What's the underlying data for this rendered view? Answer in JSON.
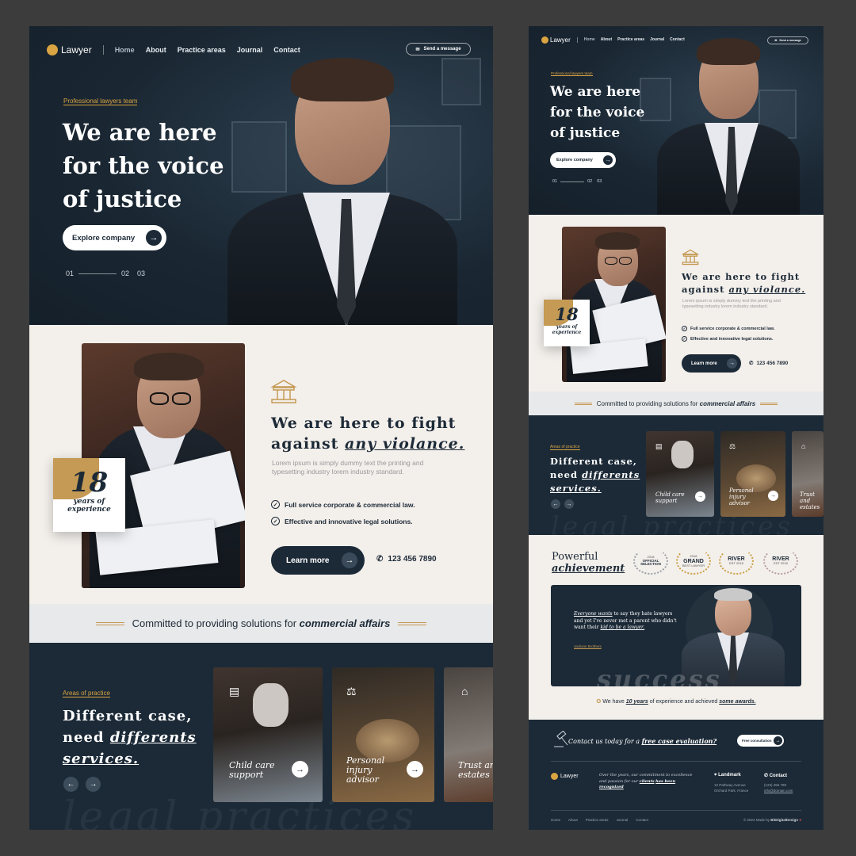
{
  "brand": {
    "logo": "Lawyer",
    "logo_icon": "pillar-icon",
    "accent": "#d9a441",
    "navy": "#1c2a37",
    "cream": "#f3efeb"
  },
  "nav": {
    "items": [
      "Home",
      "About",
      "Practice areas",
      "Journal",
      "Contact"
    ],
    "message": "Send a message"
  },
  "hero": {
    "eyebrow": "Professional lawyers team",
    "title_lines": [
      "We are here",
      "for the voice",
      "of justice"
    ],
    "cta": "Explore company",
    "slides": [
      "01",
      "02",
      "03"
    ]
  },
  "about": {
    "years": "18",
    "years_label_1": "years of",
    "years_label_2": "experience",
    "title_1": "We are here to fight",
    "title_2a": "against",
    "title_2b": "any violance.",
    "text": "Lorem ipsum is simply dummy text the printing and typesetting industry lorem industry standard.",
    "checks": [
      "Full service corporate & commercial law.",
      "Effective and innovative legal solutions."
    ],
    "learn": "Learn more",
    "phone": "123 456 7890"
  },
  "committed": {
    "text": "Committed to providing solutions for",
    "bold": "commercial affairs"
  },
  "practice": {
    "eyebrow": "Areas of practice",
    "title_1": "Different case,",
    "title_2a": "need",
    "title_2b": "differents",
    "title_3": "services.",
    "cards": [
      {
        "caption_1": "Child care",
        "caption_2": "support"
      },
      {
        "caption_1": "Personal",
        "caption_2": "injury",
        "caption_3": "advisor"
      },
      {
        "caption_1": "Trust and",
        "caption_2": "estates"
      }
    ],
    "watermark": "legal practices"
  },
  "achievement": {
    "title_1": "Powerful",
    "title_2": "achievement",
    "awards": [
      {
        "top": "2018",
        "main": "OFFICIAL SELECTION",
        "sub": ""
      },
      {
        "top": "2018",
        "main": "GRAND",
        "sub": "BEST LAWYER"
      },
      {
        "top": "",
        "main": "RIVER",
        "sub": "EST 2018"
      },
      {
        "top": "",
        "main": "RIVER",
        "sub": "EST 2018"
      }
    ],
    "quote_em": "Everyone wants",
    "quote_rest": "to say they hate lawyers and yet I've never met a parent who didn't want their",
    "quote_end": "kid to be a lawyer.",
    "author": "Jackson Brothers",
    "watermark": "success",
    "note_pre": "We have",
    "note_years": "10 years",
    "note_mid": "of experience and achieved",
    "note_end": "some awards."
  },
  "footer": {
    "cta_pre": "Contact us today for a",
    "cta_link": "free case evaluation?",
    "cta_btn": "Free consultation",
    "desc_pre": "Over the years, our commitment to excellence and passion for our",
    "desc_link1": "clients",
    "desc_link2": "has been recognized",
    "landmark_h": "Landmark",
    "landmark_t1": "12 Pathway Avenue",
    "landmark_t2": "Orchard Park, France",
    "contact_h": "Contact",
    "contact_t1": "(123) 456 789",
    "contact_t2": "info@domain.com",
    "links": [
      "Home",
      "About",
      "Practice areas",
      "Journal",
      "Contact"
    ],
    "copy_pre": "© 2024 Made by",
    "copy_name": "BitDigitalDesign"
  }
}
